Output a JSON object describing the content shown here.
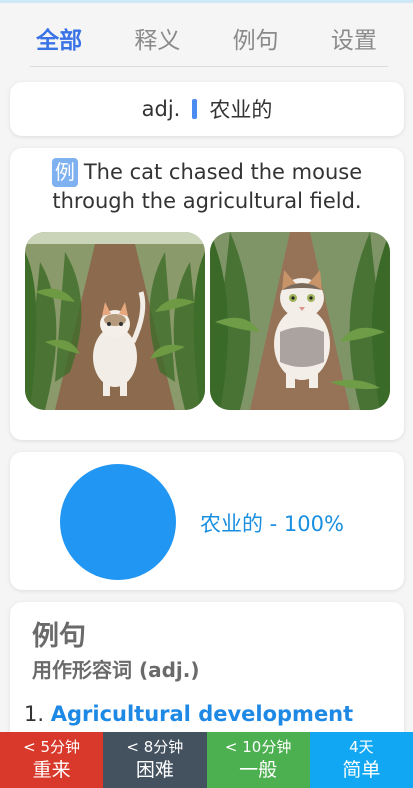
{
  "tabs": [
    "全部",
    "释义",
    "例句",
    "设置"
  ],
  "word": {
    "pos": "adj.",
    "meaning": "农业的"
  },
  "example": {
    "badge": "例",
    "text": "The cat chased the mouse through the agricultural field."
  },
  "images": [
    {
      "description": "cat walking in a corn field"
    },
    {
      "description": "cat standing in a corn field"
    }
  ],
  "chart_data": {
    "type": "pie",
    "labels": [
      "农业的"
    ],
    "values": [
      100
    ],
    "colors": [
      "#2196f3"
    ],
    "legend_text": "农业的 - 100%"
  },
  "sentences": {
    "title": "例句",
    "subtitle": "用作形容词 (adj.)",
    "items": [
      {
        "num": "1.",
        "en": "Agricultural development"
      }
    ]
  },
  "buttons": [
    {
      "time": "< 5分钟",
      "label": "重来",
      "color": "#d8392b"
    },
    {
      "time": "< 8分钟",
      "label": "困难",
      "color": "#44525f"
    },
    {
      "time": "< 10分钟",
      "label": "一般",
      "color": "#4caf50"
    },
    {
      "time": "4天",
      "label": "简单",
      "color": "#11a7f2"
    }
  ]
}
